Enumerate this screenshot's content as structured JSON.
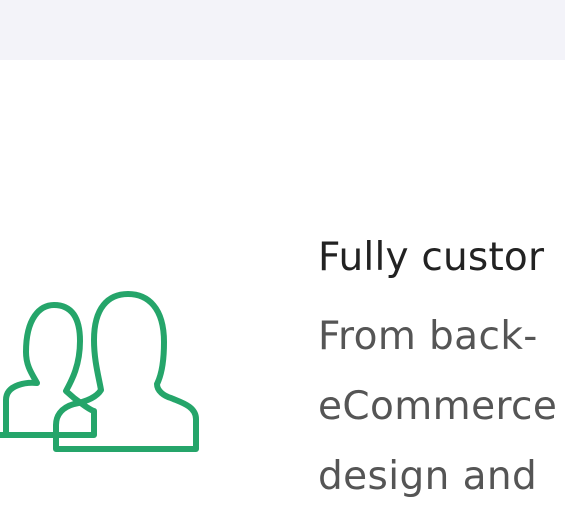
{
  "feature": {
    "title": "Fully custor",
    "description_lines": [
      "From  back-",
      "eCommerce",
      "design and"
    ],
    "icon": "users-icon",
    "accent_color": "#25a56a"
  },
  "colors": {
    "top_band": "#f3f3f9",
    "title_text": "#222222",
    "body_text": "#555555"
  }
}
